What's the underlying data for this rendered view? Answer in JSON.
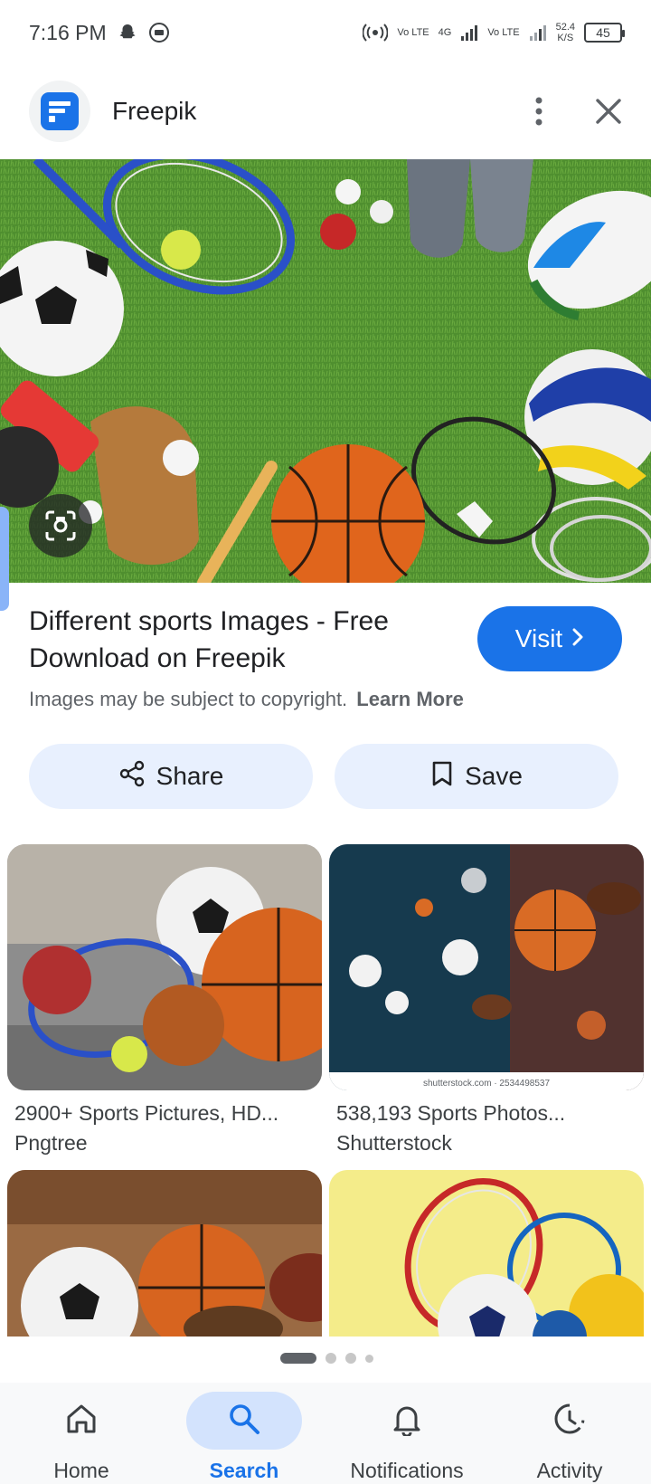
{
  "status_bar": {
    "time": "7:16 PM",
    "net_type_1": "Vo LTE",
    "net_gen": "4G",
    "net_type_2": "Vo LTE",
    "speed_value": "52.4",
    "speed_unit": "K/S",
    "battery": "45"
  },
  "header": {
    "site_name": "Freepik",
    "icons": [
      "freepik-logo",
      "more-vert-icon",
      "close-icon"
    ]
  },
  "result": {
    "title": "Different sports Images - Free Download on Freepik",
    "visit_label": "Visit",
    "copyright_text": "Images may be subject to copyright.",
    "learn_more": "Learn More"
  },
  "actions": {
    "share_label": "Share",
    "save_label": "Save"
  },
  "related": [
    {
      "title": "2900+ Sports Pictures, HD...",
      "source": "Pngtree"
    },
    {
      "title": "538,193 Sports Photos...",
      "source": "Shutterstock",
      "caption": "shutterstock.com · 2534498537"
    },
    {
      "title": "",
      "source": ""
    },
    {
      "title": "",
      "source": ""
    }
  ],
  "bottom_nav": [
    {
      "label": "Home",
      "icon": "home-icon"
    },
    {
      "label": "Search",
      "icon": "search-icon",
      "active": true
    },
    {
      "label": "Notifications",
      "icon": "bell-icon"
    },
    {
      "label": "Activity",
      "icon": "activity-icon"
    }
  ],
  "colors": {
    "accent": "#1a73e8",
    "pill_bg": "#e8f0fe",
    "nav_active_bg": "#d3e3fd",
    "grass": "#4f8f2f"
  }
}
